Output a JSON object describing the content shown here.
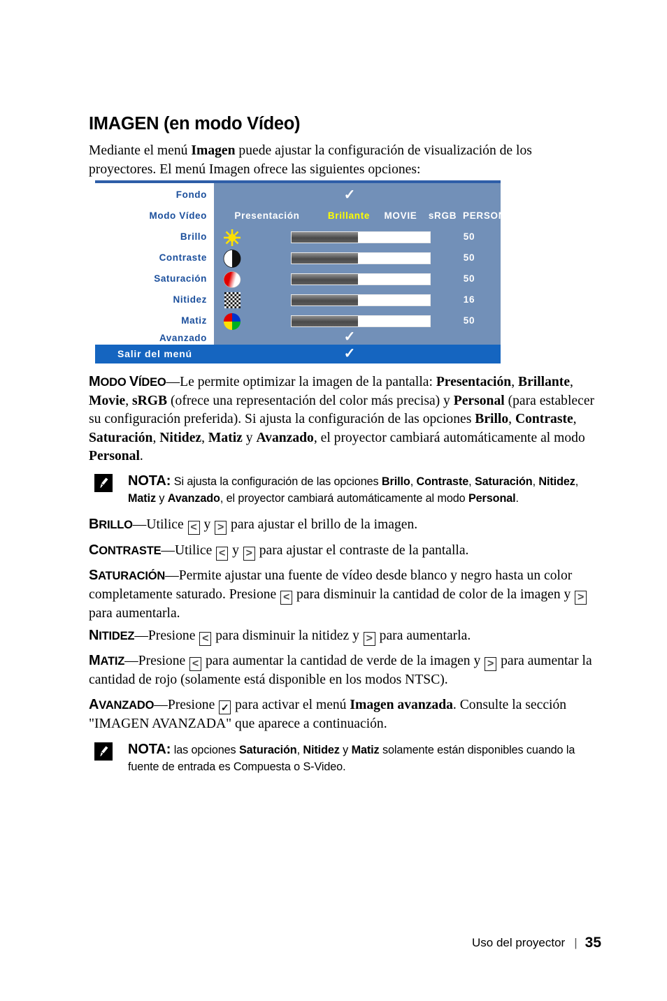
{
  "heading": "IMAGEN (en modo Vídeo)",
  "intro": {
    "line": "Mediante el menú Imagen puede ajustar la configuración de visualización de los proyectores. El menú Imagen ofrece las siguientes opciones:",
    "bold_term": "Imagen"
  },
  "osd": {
    "rows": [
      {
        "label": "Fondo",
        "type": "check",
        "check": "✓"
      },
      {
        "label": "Modo Vídeo",
        "type": "modes"
      },
      {
        "label": "Brillo",
        "type": "slider",
        "icon": "sun-icon",
        "value": "50",
        "fill_pct": 48
      },
      {
        "label": "Contraste",
        "type": "slider",
        "icon": "contrast-circle-icon",
        "value": "50",
        "fill_pct": 48
      },
      {
        "label": "Saturación",
        "type": "slider",
        "icon": "saturation-circle-icon",
        "value": "50",
        "fill_pct": 48
      },
      {
        "label": "Nitidez",
        "type": "slider",
        "icon": "checkerboard-icon",
        "value": "16",
        "fill_pct": 48
      },
      {
        "label": "Matiz",
        "type": "slider",
        "icon": "color-wheel-icon",
        "value": "50",
        "fill_pct": 48
      },
      {
        "label": "Avanzado",
        "type": "check",
        "check": "✓"
      }
    ],
    "video_modes": [
      {
        "label": "Presentación",
        "selected": false
      },
      {
        "label": "Brillante",
        "selected": true
      },
      {
        "label": "MOVIE",
        "selected": false
      },
      {
        "label": "sRGB",
        "selected": false
      },
      {
        "label": "PERSONAL",
        "selected": false
      }
    ],
    "exit": {
      "label": "Salir del menú",
      "check": "✓"
    },
    "colors": {
      "panel_blue": "#7290b8",
      "exit_blue": "#1565c0",
      "border_blue": "#2e5ea8",
      "label_blue": "#1b4f9c",
      "selected_mode": "#ffff00"
    }
  },
  "sections": {
    "modo_video": {
      "term_small": "ODO",
      "term_cap1": "M",
      "term_cap2": "V",
      "term_small2": "ÍDEO",
      "term_full": "Modo Vídeo",
      "text": "—Le permite optimizar la imagen de la pantalla: Presentación, Brillante, Movie, sRGB (ofrece una representación del color más precisa) y Personal (para establecer su configuración preferida). Si ajusta la configuración de las opciones Brillo, Contraste, Saturación, Nitidez, Matiz y Avanzado, el proyector cambiará automáticamente al modo Personal."
    },
    "brillo": {
      "term_full": "Brillo",
      "text": "—Utilice < y > para ajustar el brillo de la imagen."
    },
    "contraste": {
      "term_full": "Contraste",
      "text": "—Utilice < y > para ajustar el contraste de la pantalla."
    },
    "saturacion": {
      "term_full": "Saturación",
      "text": "—Permite ajustar una fuente de vídeo desde blanco y negro hasta un color completamente saturado. Presione < para disminuir la cantidad de color de la imagen y > para aumentarla."
    },
    "nitidez": {
      "term_full": "Nitidez",
      "text": "—Presione < para disminuir la nitidez y > para aumentarla."
    },
    "matiz": {
      "term_full": "Matiz",
      "text": "—Presione < para aumentar la cantidad de verde de la imagen y > para aumentar la cantidad de rojo (solamente está disponible en los modos NTSC)."
    },
    "avanzado": {
      "term_full": "Avanzado",
      "text": "—Presione ✓ para activar el menú Imagen avanzada. Consulte la sección \"IMAGEN AVANZADA\" que aparece a continuación."
    }
  },
  "notes": [
    {
      "lead": "NOTA:",
      "text": "Si ajusta la configuración de las opciones Brillo, Contraste, Saturación, Nitidez, Matiz y Avanzado, el proyector cambiará automáticamente al modo Personal."
    },
    {
      "lead": "NOTA:",
      "text": "las opciones Saturación, Nitidez y Matiz solamente están disponibles cuando la fuente de entrada es Compuesta o S-Video."
    }
  ],
  "footer": {
    "label": "Uso del proyector",
    "separator": "|",
    "page": "35"
  }
}
